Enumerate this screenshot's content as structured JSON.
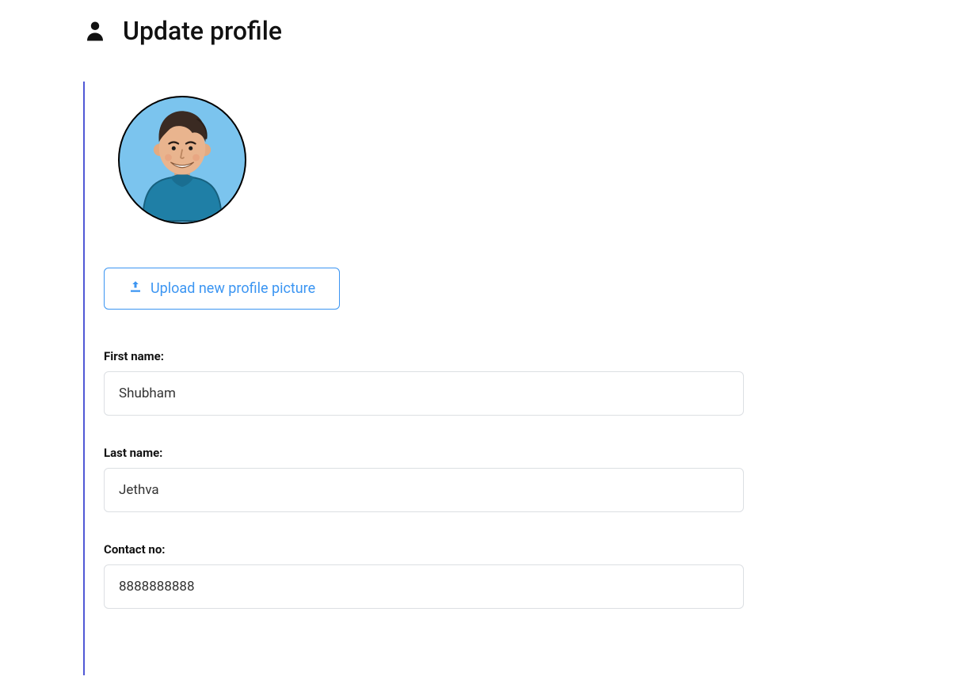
{
  "header": {
    "title": "Update profile"
  },
  "profile": {
    "upload_label": "Upload new profile picture"
  },
  "form": {
    "first_name": {
      "label": "First name:",
      "value": "Shubham"
    },
    "last_name": {
      "label": "Last name:",
      "value": "Jethva"
    },
    "contact_no": {
      "label": "Contact no:",
      "value": "8888888888"
    }
  }
}
